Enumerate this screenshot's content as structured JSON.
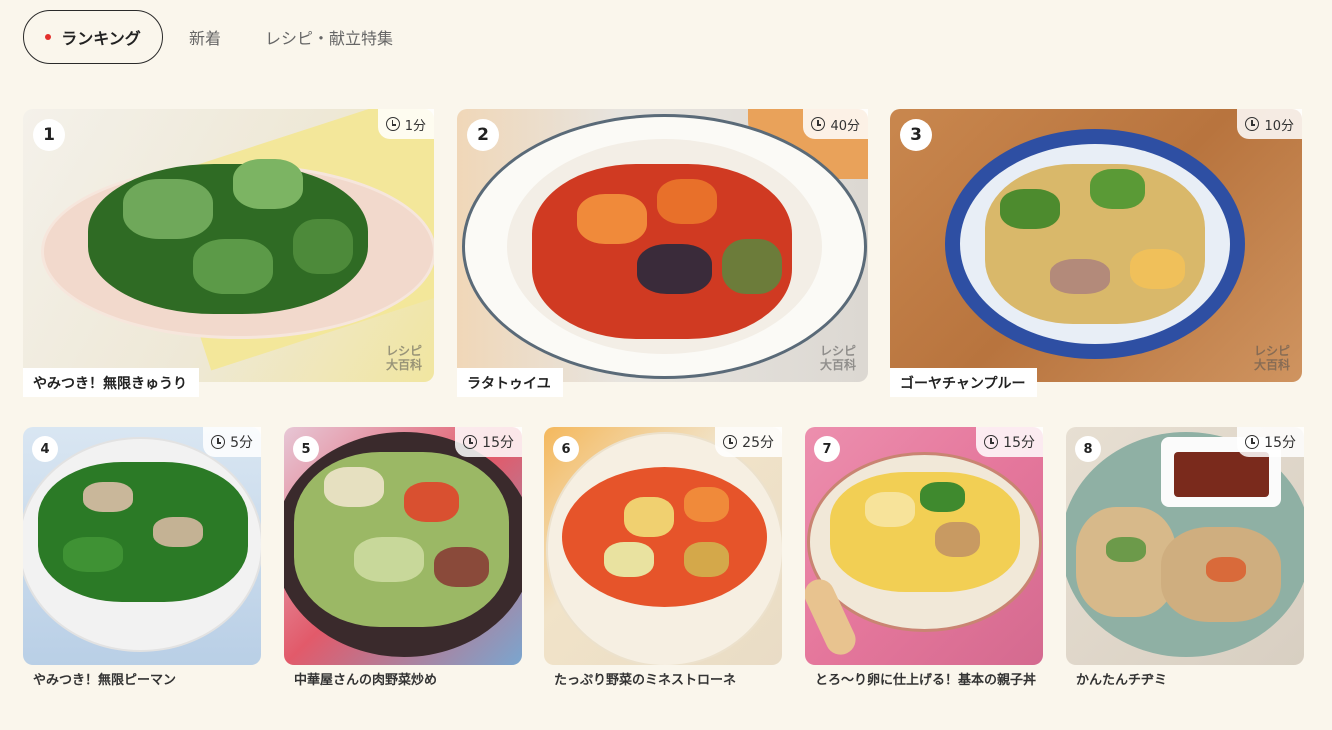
{
  "tabs": {
    "ranking": "ランキング",
    "new": "新着",
    "features": "レシピ・献立特集"
  },
  "colors": {
    "background": "#faf6ec",
    "active_dot": "#e3302c",
    "active_border": "#2a2a2a"
  },
  "watermark": [
    "レシピ",
    "大百科"
  ],
  "recipes": [
    {
      "rank": "1",
      "time": "1分",
      "title": "やみつき！無限きゅうり",
      "icon": "clock-icon"
    },
    {
      "rank": "2",
      "time": "40分",
      "title": "ラタトゥイユ",
      "icon": "clock-icon"
    },
    {
      "rank": "3",
      "time": "10分",
      "title": "ゴーヤチャンプルー",
      "icon": "clock-icon"
    },
    {
      "rank": "4",
      "time": "5分",
      "title": "やみつき！無限ピーマン",
      "icon": "clock-icon"
    },
    {
      "rank": "5",
      "time": "15分",
      "title": "中華屋さんの肉野菜炒め",
      "icon": "clock-icon"
    },
    {
      "rank": "6",
      "time": "25分",
      "title": "たっぷり野菜のミネストローネ",
      "icon": "clock-icon"
    },
    {
      "rank": "7",
      "time": "15分",
      "title": "とろ〜り卵に仕上げる！基本の親子丼",
      "icon": "clock-icon"
    },
    {
      "rank": "8",
      "time": "15分",
      "title": "かんたんチヂミ",
      "icon": "clock-icon"
    }
  ]
}
